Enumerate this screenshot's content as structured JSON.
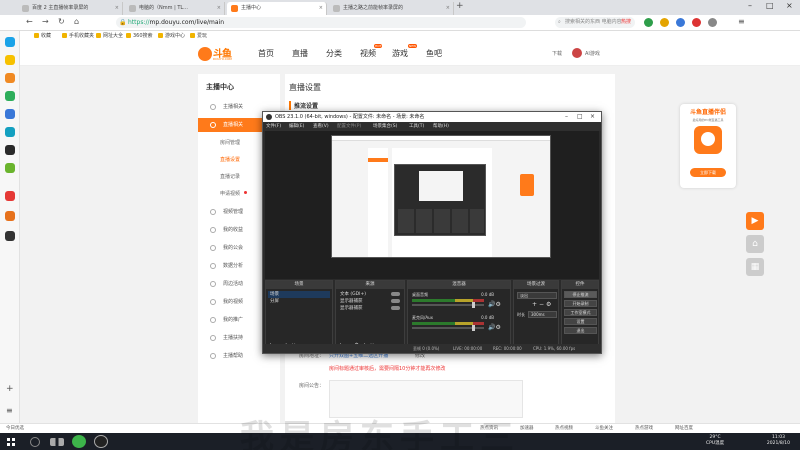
{
  "browser": {
    "tabs": [
      {
        "label": "百度 2 主直播帧率录屏的"
      },
      {
        "label": "电脑的（Nmm | TL..."
      },
      {
        "label": "主播中心"
      },
      {
        "label": "主播之路之前能帧率录屏的"
      }
    ],
    "active_tab": 2,
    "url": "https://mp.douyu.com/live/main",
    "url_scheme": "https://",
    "url_rest": "mp.douyu.com/live/main",
    "search_placeholder": "搜索相关的东西 电脑内容",
    "search_hot": "热搜",
    "bookmarks": [
      "收藏",
      "手机收藏夹",
      "网址大全",
      "360搜索",
      "游戏中心",
      "爱玩"
    ]
  },
  "site": {
    "logo": "斗鱼",
    "logo_sub": "DOUYU.COM",
    "nav": [
      "首页",
      "直播",
      "分类",
      "视频",
      "游戏",
      "鱼吧"
    ],
    "nav_badges": {
      "video": "HOT",
      "game": "NEW"
    },
    "download": "下载",
    "user": "AI游戏"
  },
  "anchor_nav": {
    "title": "主播中心",
    "items": [
      {
        "label": "主播相关"
      },
      {
        "label": "直播相关",
        "active": true
      },
      {
        "label": "房间管理",
        "sub": true
      },
      {
        "label": "直播设置",
        "sub": true,
        "highlight": true
      },
      {
        "label": "直播记录",
        "sub": true
      },
      {
        "label": "申请视频",
        "sub": true,
        "dot": true
      },
      {
        "label": "视频管理"
      },
      {
        "label": "我的收益"
      },
      {
        "label": "我的公会"
      },
      {
        "label": "数据分析"
      },
      {
        "label": "周边活动"
      },
      {
        "label": "我的视频"
      },
      {
        "label": "我的推广"
      },
      {
        "label": "主播扶持"
      },
      {
        "label": "主播帮助"
      }
    ]
  },
  "main": {
    "title": "直播设置",
    "subtitle": "推流设置",
    "notice_label": "房间地址：",
    "notice_link": "只开双图+五维二选区开播",
    "notice_edit": "修改",
    "notice_warn": "房间标题通过审核后，需要间隔10分钟才能再次修改",
    "announce_label": "房间公告："
  },
  "promo": {
    "title": "斗鱼直播伴侣",
    "desc": "最好用的PC端直播工具",
    "button": "立即下载"
  },
  "obs": {
    "title": "OBS 23.1.0 (64-bit, windows) - 配置文件: 未命名 - 场景: 未命名",
    "menu": [
      "文件(F)",
      "编辑(E)",
      "查看(V)",
      "配置文件(P)",
      "场景集合(S)",
      "工具(T)",
      "帮助(H)"
    ],
    "docks": {
      "scenes": {
        "title": "场景",
        "items": [
          "场景",
          "分屏"
        ]
      },
      "sources": {
        "title": "来源",
        "items": [
          "文本 (GDI+)",
          "显示器捕获",
          "显示器捕获"
        ]
      },
      "mixer": {
        "title": "混音器",
        "rows": [
          {
            "name": "桌面音频",
            "db": "0.0 dB"
          },
          {
            "name": "麦克风/Aux",
            "db": "0.0 dB"
          }
        ]
      },
      "transitions": {
        "title": "场景过渡",
        "type": "淡出",
        "duration_label": "时长",
        "duration": "300ms"
      },
      "controls": {
        "title": "控件",
        "buttons": [
          "停止推流",
          "开始录制",
          "工作室模式",
          "设置",
          "退出"
        ]
      }
    },
    "status": {
      "live": "LIVE: 00:00:00",
      "rec": "REC: 00:00:00",
      "cpu": "CPU: 1.9%, 60.00 fps",
      "dropped": "丢帧 0 (0.0%)"
    }
  },
  "page_footer": [
    "今日优选",
    "热点资讯",
    "加速器",
    "热点视频",
    "斗鱼关注",
    "热点游戏",
    "网址百度"
  ],
  "taskbar": {
    "temp": "29°C",
    "temp_label": "CPU温度",
    "time": "11:03",
    "date": "2021/8/10"
  },
  "watermark": "我是房东手工三"
}
